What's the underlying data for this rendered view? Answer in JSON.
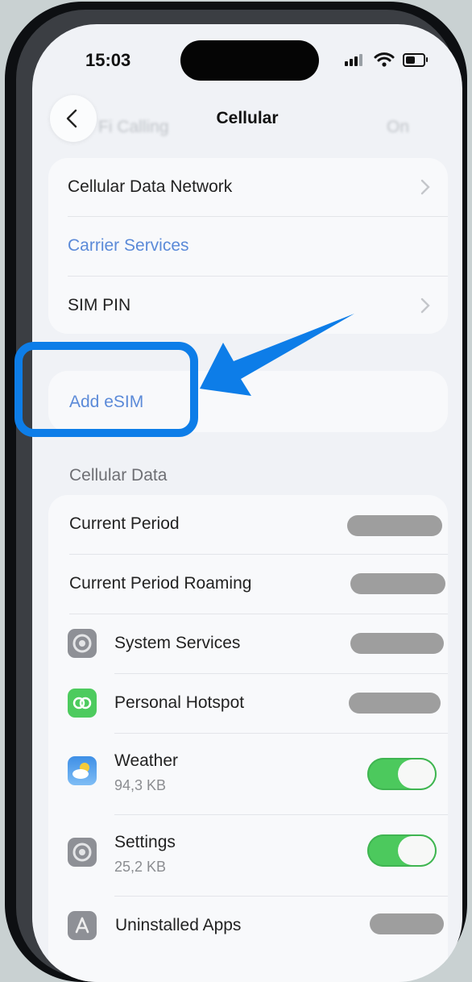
{
  "status_bar": {
    "time": "15:03"
  },
  "nav": {
    "title": "Cellular",
    "back_icon": "chevron-left-icon"
  },
  "ghost_text": {
    "left": "Fi Calling",
    "right": "On"
  },
  "top_group": [
    {
      "label": "Cellular Data Network",
      "style": "normal",
      "chevron": true
    },
    {
      "label": "Carrier Services",
      "style": "link",
      "chevron": false
    },
    {
      "label": "SIM PIN",
      "style": "normal",
      "chevron": true
    }
  ],
  "esim": {
    "label": "Add eSIM"
  },
  "cellular_data": {
    "header": "Cellular Data",
    "rows": [
      {
        "label": "Current Period",
        "value": ""
      },
      {
        "label": "Current Period Roaming",
        "value": ""
      },
      {
        "label": "System Services",
        "icon": "gear-icon",
        "value": ""
      },
      {
        "label": "Personal Hotspot",
        "icon": "hotspot-icon",
        "value": ""
      },
      {
        "label": "Weather",
        "icon": "weather-icon",
        "sub": "94,3 KB",
        "toggle": true
      },
      {
        "label": "Settings",
        "icon": "gear-icon",
        "sub": "25,2 KB",
        "toggle": true
      },
      {
        "label": "Uninstalled Apps",
        "icon": "app-store-icon",
        "value": ""
      }
    ]
  },
  "colors": {
    "accent": "#0d7de8",
    "link": "#5b8ad8",
    "toggle_on": "#4cc95d",
    "redacted": "#9e9e9e"
  }
}
